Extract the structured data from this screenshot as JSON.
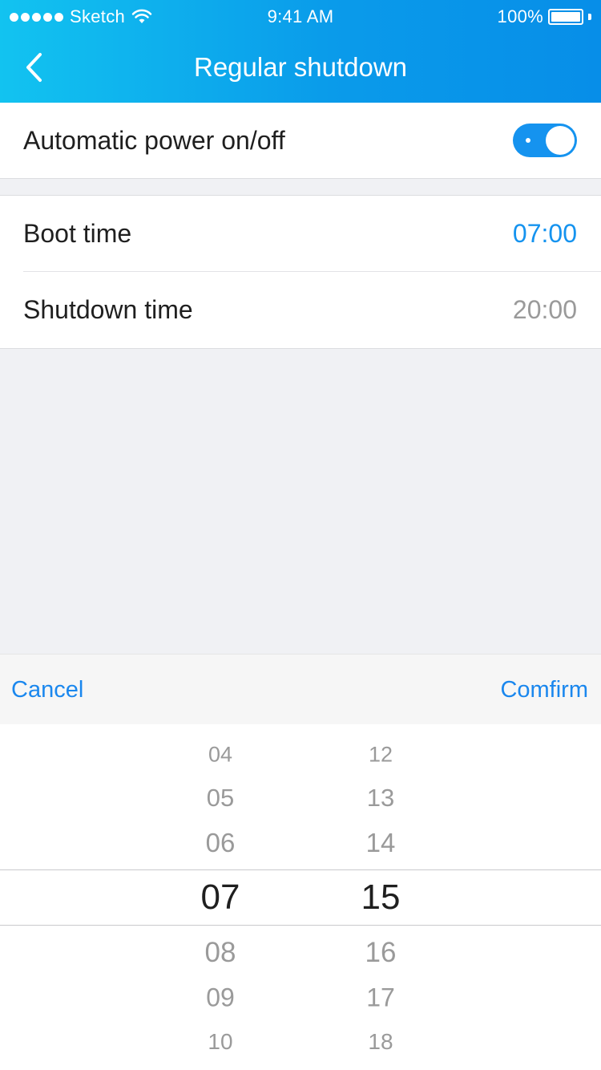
{
  "status_bar": {
    "carrier": "Sketch",
    "time": "9:41 AM",
    "battery": "100%",
    "battery_level": 1.0
  },
  "nav": {
    "title": "Regular shutdown",
    "back_icon": "chevron-left-icon"
  },
  "auto_power": {
    "label": "Automatic power on/off",
    "enabled": true
  },
  "times": {
    "boot": {
      "label": "Boot time",
      "value": "07:00",
      "color": "#1593ef"
    },
    "shutdown": {
      "label": "Shutdown time",
      "value": "20:00",
      "color": "#9a9a9a"
    }
  },
  "picker": {
    "cancel_label": "Cancel",
    "confirm_label": "Comfirm",
    "hours": [
      "04",
      "05",
      "06",
      "07",
      "08",
      "09",
      "10"
    ],
    "minutes": [
      "12",
      "13",
      "14",
      "15",
      "16",
      "17",
      "18"
    ],
    "selected_hour": "07",
    "selected_minute": "15"
  },
  "colors": {
    "accent": "#1593ef",
    "header_start": "#12c3f0",
    "header_end": "#078ee8",
    "background": "#f0f1f4"
  }
}
